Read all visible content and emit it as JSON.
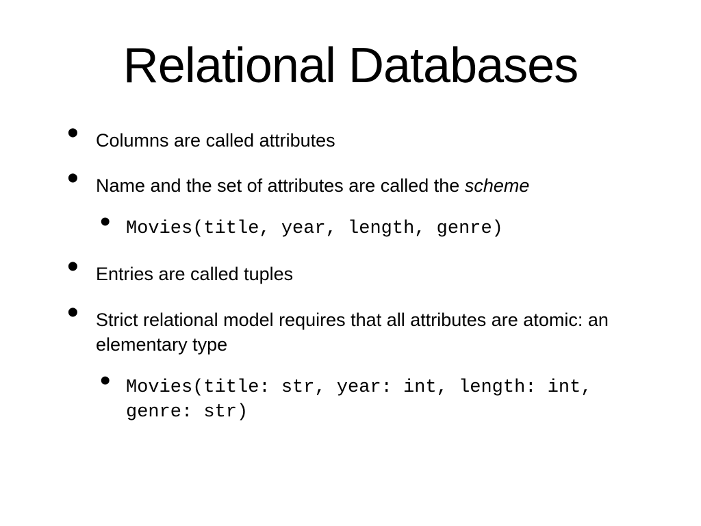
{
  "title": "Relational Databases",
  "bullets": {
    "b1": "Columns are called attributes",
    "b2_pre": "Name and the set of attributes are called the ",
    "b2_em": "scheme",
    "b2_sub": "Movies(title, year, length, genre)",
    "b3": "Entries are called tuples",
    "b4": "Strict relational model requires that all attributes are atomic: an elementary type",
    "b4_sub": "Movies(title: str, year: int, length: int, genre: str)"
  }
}
